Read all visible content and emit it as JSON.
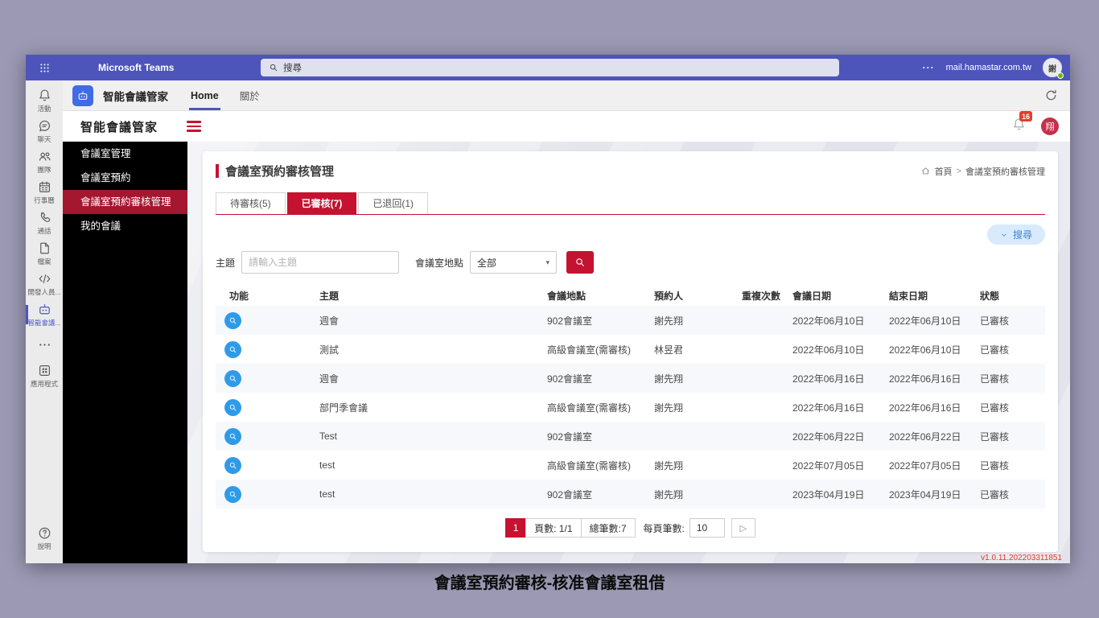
{
  "teams_bar": {
    "app_name": "Microsoft Teams",
    "search_placeholder": "搜尋",
    "more_label": "···",
    "domain": "mail.hamastar.com.tw",
    "avatar_initial": "謝"
  },
  "tab_bar": {
    "app_title": "智能會議管家",
    "tabs": [
      {
        "name": "home",
        "label": "Home",
        "active": true
      },
      {
        "name": "about",
        "label": "關於",
        "active": false
      }
    ]
  },
  "rail": {
    "items": [
      {
        "name": "activity",
        "label": "活動",
        "icon": "bell-icon",
        "active": false
      },
      {
        "name": "chat",
        "label": "聊天",
        "icon": "chat-icon",
        "active": false
      },
      {
        "name": "teams",
        "label": "團隊",
        "icon": "people-icon",
        "active": false
      },
      {
        "name": "calendar",
        "label": "行事曆",
        "icon": "calendar-icon",
        "active": false
      },
      {
        "name": "calls",
        "label": "通話",
        "icon": "phone-icon",
        "active": false
      },
      {
        "name": "files",
        "label": "檔案",
        "icon": "file-icon",
        "active": false
      },
      {
        "name": "developer",
        "label": "開發人員...",
        "icon": "developer-icon",
        "active": false
      },
      {
        "name": "smart-meeting",
        "label": "智能會議...",
        "icon": "bot-icon",
        "active": true
      },
      {
        "name": "more",
        "label": "",
        "icon": "more-icon",
        "active": false
      },
      {
        "name": "apps",
        "label": "應用程式",
        "icon": "apps-icon",
        "active": false
      }
    ],
    "help_label": "說明"
  },
  "app_header": {
    "title": "智能會議管家",
    "notification_count": "16",
    "avatar_initial": "翔"
  },
  "sidebar": {
    "items": [
      {
        "name": "room-management",
        "label": "會議室管理",
        "active": false
      },
      {
        "name": "room-reservation",
        "label": "會議室預約",
        "active": false
      },
      {
        "name": "reservation-review",
        "label": "會議室預約審核管理",
        "active": true
      },
      {
        "name": "my-meetings",
        "label": "我的會議",
        "active": false
      }
    ]
  },
  "main": {
    "page_title": "會議室預約審核管理",
    "breadcrumb": {
      "home": "首頁",
      "separator": ">",
      "current": "會議室預約審核管理"
    },
    "tabs": [
      {
        "name": "pending",
        "label": "待審核(5)",
        "active": false
      },
      {
        "name": "approved",
        "label": "已審核(7)",
        "active": true
      },
      {
        "name": "returned",
        "label": "已退回(1)",
        "active": false
      }
    ],
    "search_toggle_label": "搜尋",
    "filters": {
      "subject_label": "主題",
      "subject_placeholder": "請輸入主題",
      "location_label": "會議室地點",
      "location_value": "全部"
    },
    "table": {
      "headers": [
        "功能",
        "主題",
        "會議地點",
        "預約人",
        "重複次數",
        "會議日期",
        "結束日期",
        "狀態"
      ],
      "rows": [
        {
          "subject": "週會",
          "location": "902會議室",
          "reserver": "謝先翔",
          "repeat": "",
          "start_date": "2022年06月10日",
          "end_date": "2022年06月10日",
          "status": "已審核"
        },
        {
          "subject": "測試",
          "location": "高級會議室(需審核)",
          "reserver": "林昱君",
          "repeat": "",
          "start_date": "2022年06月10日",
          "end_date": "2022年06月10日",
          "status": "已審核"
        },
        {
          "subject": "週會",
          "location": "902會議室",
          "reserver": "謝先翔",
          "repeat": "",
          "start_date": "2022年06月16日",
          "end_date": "2022年06月16日",
          "status": "已審核"
        },
        {
          "subject": "部門季會議",
          "location": "高級會議室(需審核)",
          "reserver": "謝先翔",
          "repeat": "",
          "start_date": "2022年06月16日",
          "end_date": "2022年06月16日",
          "status": "已審核"
        },
        {
          "subject": "Test",
          "location": "902會議室",
          "reserver": "",
          "repeat": "",
          "start_date": "2022年06月22日",
          "end_date": "2022年06月22日",
          "status": "已審核"
        },
        {
          "subject": "test",
          "location": "高級會議室(需審核)",
          "reserver": "謝先翔",
          "repeat": "",
          "start_date": "2022年07月05日",
          "end_date": "2022年07月05日",
          "status": "已審核"
        },
        {
          "subject": "test",
          "location": "902會議室",
          "reserver": "謝先翔",
          "repeat": "",
          "start_date": "2023年04月19日",
          "end_date": "2023年04月19日",
          "status": "已審核"
        }
      ]
    },
    "pagination": {
      "page_button": "1",
      "page_info": "頁數: 1/1",
      "total_info": "總筆數:7",
      "per_page_label": "每頁筆數:",
      "per_page_value": "10",
      "next_icon": "▷"
    },
    "version": "v1.0.11.202203311851"
  },
  "caption": "會議室預約審核-核准會議室租借",
  "colors": {
    "teams_purple": "#4D55BB",
    "accent_red": "#C51230",
    "sidebar_active_red": "#A5162F",
    "view_button_blue": "#2E9BE8",
    "search_pill_bg": "#D9EAFC",
    "search_pill_text": "#3D85D8",
    "app_icon_blue": "#3F6BE5",
    "avatar_red": "#C4314B",
    "badge_red": "#E53E2E",
    "version_red": "#E5352B",
    "presence_green": "#6BB700"
  }
}
